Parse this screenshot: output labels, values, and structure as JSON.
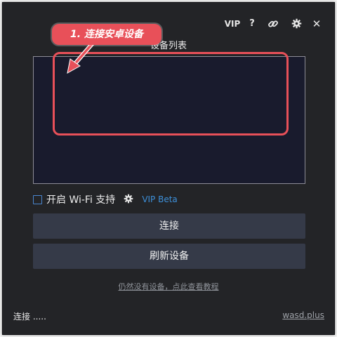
{
  "titlebar": {
    "vip_label": "VIP",
    "help_label": "?",
    "link_icon": "link-icon",
    "settings_icon": "gear-icon",
    "close_label": "✕"
  },
  "device_list": {
    "title": "设备列表",
    "items": []
  },
  "wifi": {
    "checked": false,
    "label": "开启 Wi-Fi 支持",
    "settings_icon": "gear-icon",
    "badge": "VIP Beta"
  },
  "buttons": {
    "connect": "连接",
    "refresh": "刷新设备"
  },
  "help_link": "仍然没有设备，点此查看教程",
  "status": "连接 .....",
  "site_link": "wasd.plus",
  "annotation": {
    "callout_text": "1. 连接安卓设备",
    "color": "#e85059"
  },
  "colors": {
    "window_bg": "#232427",
    "list_bg": "#191b2d",
    "button_bg": "#353a48",
    "accent_blue": "#3d8fd8"
  }
}
